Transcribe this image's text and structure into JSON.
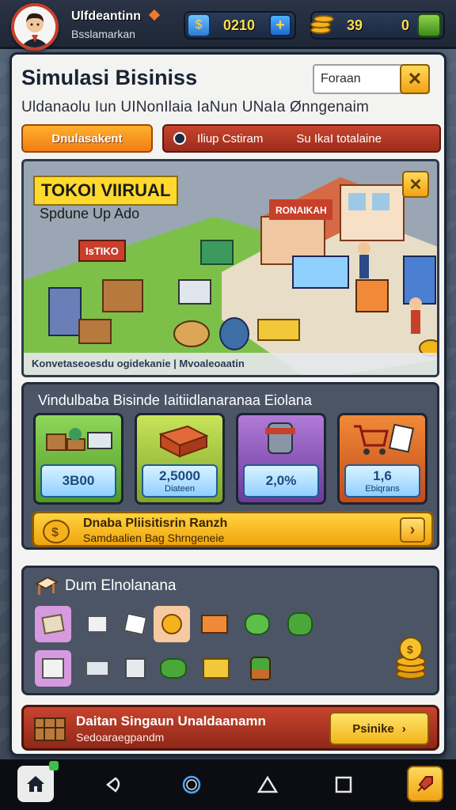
{
  "header": {
    "player_name": "Ulfdeantinn",
    "player_subtitle": "Bsslamarkan",
    "currency_1": "0210",
    "currency_2": "39",
    "currency_3": "0"
  },
  "main": {
    "title": "Simulasi Bisiniss",
    "search_placeholder": "Foraan",
    "search_button": "✕",
    "subtitle": "Uldanaolu Iun UINonIlaia IaNun UNaIa Ønngenaim",
    "tabs": [
      {
        "label": "Dnulasakent"
      },
      {
        "label": "Iliup Cstiram"
      },
      {
        "label": "Su IkaI totalaine"
      }
    ]
  },
  "scene": {
    "title": "TOKOI VIIRUAL",
    "subtitle": "Spdune Up Ado",
    "caption": "Konvetaseoesdu ogidekanie | Mvoaleoaatin",
    "sign_1": "IsTIKO",
    "sign_2": "RONAIKAH"
  },
  "stats": {
    "title": "Vindulbaba Bisinde Iaitiidlanaranaa Eiolana",
    "cards": [
      {
        "value": "3B00",
        "label": ""
      },
      {
        "value": "2,5000",
        "label": "Diateen"
      },
      {
        "value": "2,0%",
        "label": ""
      },
      {
        "value": "1,6",
        "label": "Ebiqrans"
      }
    ],
    "promo_title": "Dnaba Pliisitisrin Ranzh",
    "promo_sub": "Samdaalien Bag Shrngeneie"
  },
  "items": {
    "title": "Dum Elnolanana"
  },
  "footer": {
    "title": "Daitan Singaun Unaldaanamn",
    "subtitle": "Sedoaraegpandm",
    "button": "Psinike"
  },
  "colors": {
    "accent_orange": "#f07e15",
    "accent_red": "#b33a25",
    "accent_yellow": "#ffd340",
    "panel_bg": "#f3f3f2",
    "dark_box": "#4b5566"
  }
}
